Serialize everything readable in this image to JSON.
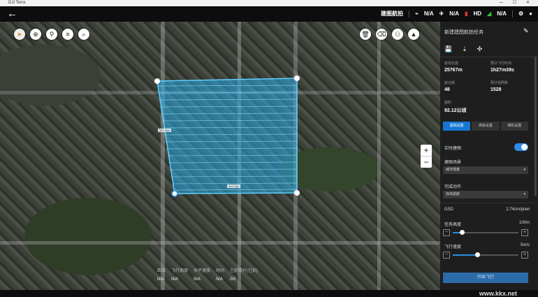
{
  "window": {
    "title": "DJI Terra",
    "controls": "— ☐ ✕"
  },
  "topbar": {
    "back_icon": "←",
    "mode": "建图航拍",
    "s1": "N/A",
    "s2": "N/A",
    "s3": "HD",
    "s4": "N/A"
  },
  "map": {
    "left_tools": [
      "compass-icon",
      "locate-icon",
      "pin-icon",
      "menu-icon",
      "search-icon"
    ],
    "right_tools": [
      "trash-icon",
      "eraser-icon",
      "users-icon",
      "navigate-icon"
    ],
    "zoom_in": "+",
    "zoom_out": "−",
    "area_labels": [
      "337.5km",
      "342.1km"
    ]
  },
  "stats": [
    {
      "label": "距离",
      "value": "N/A"
    },
    {
      "label": "飞行高度",
      "value": "N/A"
    },
    {
      "label": "水平速度",
      "value": "N/A"
    },
    {
      "label": "时间",
      "value": "N/A"
    },
    {
      "label": "已拍照片(已拍)",
      "value": "0/0"
    }
  ],
  "panel": {
    "title": "新建建图航拍任务",
    "info": [
      {
        "label": "航线长度",
        "value": "25767m"
      },
      {
        "label": "预计飞行时间",
        "value": "1h27m39s"
      },
      {
        "label": "航点数",
        "value": "48"
      },
      {
        "label": "预计拍照数",
        "value": "1528"
      },
      {
        "label": "面积",
        "value": "92.12公顷"
      }
    ],
    "tabs": [
      "基础设置",
      "高级设置",
      "相机设置"
    ],
    "realtime_label": "实时建图",
    "scene_label": "建图场景",
    "scene_value": "城市场景",
    "finish_label": "完成动作",
    "finish_value": "自动返航",
    "gsd_label": "GSD",
    "gsd_value": "2.74cm/pixel",
    "alt_label": "任务高度",
    "alt_value": "100m",
    "alt_level": 0.14,
    "speed_label": "飞行速度",
    "speed_value": "5m/s",
    "speed_level": 0.37,
    "start_label": "开始飞行"
  },
  "watermark": "www.kkx.net"
}
